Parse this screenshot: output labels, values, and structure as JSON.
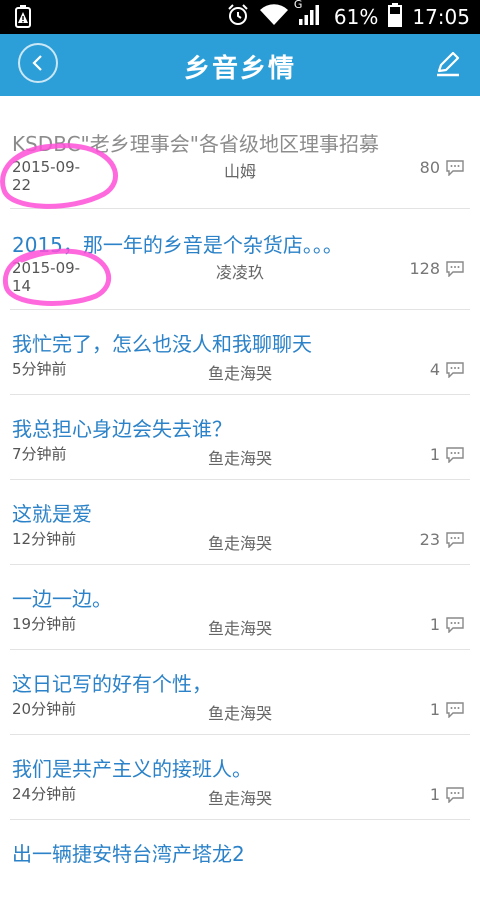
{
  "status_bar": {
    "network": "G",
    "battery": "61%",
    "time": "17:05"
  },
  "header": {
    "title": "乡音乡情"
  },
  "posts": [
    {
      "title": "KSDBC\"老乡理事会\"各省级地区理事招募",
      "date": "2015-09-22",
      "author": "山姆",
      "comments": "80"
    },
    {
      "title": "2015，那一年的乡音是个杂货店。。。",
      "date": "2015-09-14",
      "author": "凌凌玖",
      "comments": "128"
    },
    {
      "title": "我忙完了，怎么也没人和我聊聊天",
      "date": "5分钟前",
      "author": "鱼走海哭",
      "comments": "4"
    },
    {
      "title": "我总担心身边会失去谁？",
      "date": "7分钟前",
      "author": "鱼走海哭",
      "comments": "1"
    },
    {
      "title": "这就是爱",
      "date": "12分钟前",
      "author": "鱼走海哭",
      "comments": "23"
    },
    {
      "title": "一边一边。",
      "date": "19分钟前",
      "author": "鱼走海哭",
      "comments": "1"
    },
    {
      "title": "这日记写的好有个性，",
      "date": "20分钟前",
      "author": "鱼走海哭",
      "comments": "1"
    },
    {
      "title": "我们是共产主义的接班人。",
      "date": "24分钟前",
      "author": "鱼走海哭",
      "comments": "1"
    },
    {
      "title": "出一辆捷安特台湾产塔龙2",
      "date": "",
      "author": "",
      "comments": ""
    }
  ],
  "colors": {
    "appbar": "#2c9fd8",
    "title_link": "#2b82c8",
    "highlight": "#ff4fd8"
  }
}
